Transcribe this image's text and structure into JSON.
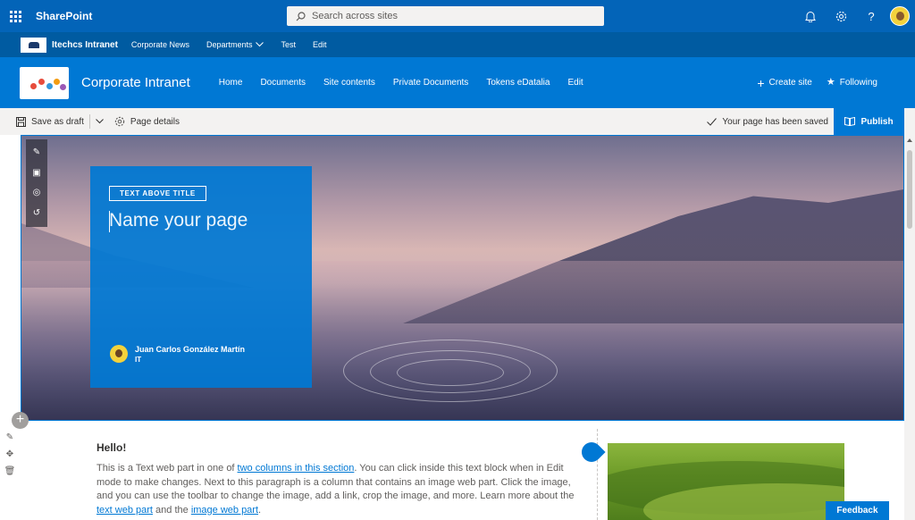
{
  "suite": {
    "app_name": "SharePoint",
    "search_placeholder": "Search across sites"
  },
  "hub": {
    "title": "Itechcs Intranet",
    "links": [
      "Corporate News",
      "Departments",
      "Test",
      "Edit"
    ]
  },
  "site": {
    "title": "Corporate Intranet",
    "nav": [
      "Home",
      "Documents",
      "Site contents",
      "Private Documents",
      "Tokens eDatalia",
      "Edit"
    ],
    "create_site": "Create site",
    "following": "Following"
  },
  "commandbar": {
    "save_draft": "Save as draft",
    "page_details": "Page details",
    "saved_status": "Your page has been saved",
    "publish": "Publish"
  },
  "hero": {
    "topic_header": "TEXT ABOVE TITLE",
    "title_placeholder": "Name your page",
    "author_name": "Juan Carlos González Martín",
    "author_dept": "IT"
  },
  "content": {
    "heading": "Hello!",
    "p_1": "This is a Text web part in one of ",
    "link_1": "two columns in this section",
    "p_2": ". You can click inside this text block when in Edit mode to make changes. Next to this paragraph is a column that contains an image web part. Click the image, and you can use the toolbar to change the image, add a link, crop the image, and more. Learn more about the ",
    "link_2": "text web part",
    "p_3": " and the ",
    "link_3": "image web part",
    "p_4": "."
  },
  "feedback": "Feedback",
  "colors": {
    "suite_bar": "#0364b8",
    "hub_bar": "#005ba1",
    "site_header": "#0078d4",
    "accent": "#0078d4"
  }
}
